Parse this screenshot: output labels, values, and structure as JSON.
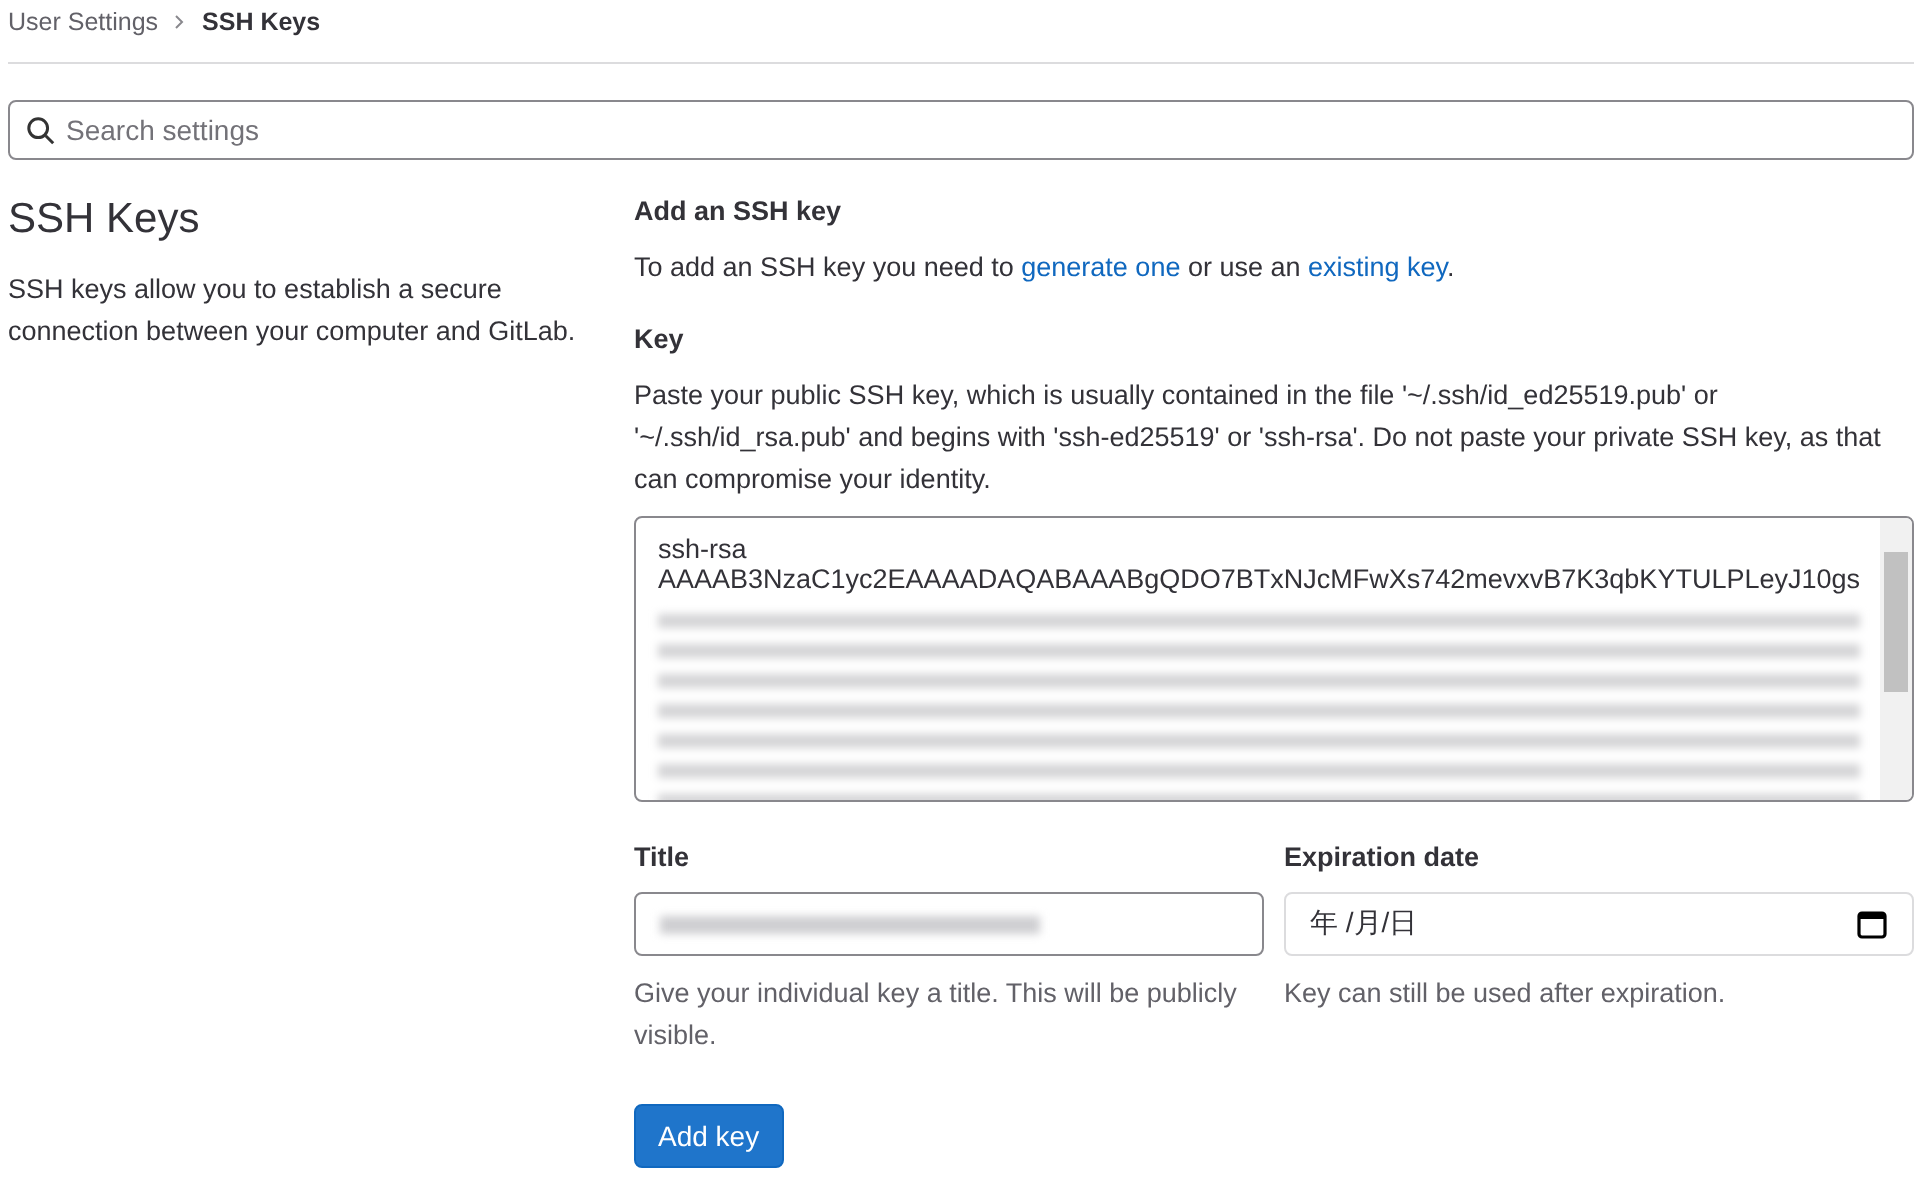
{
  "breadcrumb": [
    {
      "label": "User Settings",
      "current": false
    },
    {
      "label": "SSH Keys",
      "current": true
    }
  ],
  "search": {
    "placeholder": "Search settings"
  },
  "section": {
    "title": "SSH Keys",
    "description": "SSH keys allow you to establish a secure connection between your computer and GitLab."
  },
  "form": {
    "heading": "Add an SSH key",
    "intro": [
      {
        "kind": "text",
        "text": "To add an SSH key you need to "
      },
      {
        "kind": "link",
        "text": "generate one"
      },
      {
        "kind": "text",
        "text": " or use an "
      },
      {
        "kind": "link",
        "text": "existing key"
      },
      {
        "kind": "text",
        "text": "."
      }
    ],
    "key": {
      "label": "Key",
      "help": "Paste your public SSH key, which is usually contained in the file '~/.ssh/id_ed25519.pub' or '~/.ssh/id_rsa.pub' and begins with 'ssh-ed25519' or 'ssh-rsa'. Do not paste your private SSH key, as that can compromise your identity.",
      "value_lines": [
        "ssh-rsa",
        "AAAAB3NzaC1yc2EAAAADAQABAAABgQDO7BTxNJcMFwXs742mevxvB7K3qbKYTULPLeyJ10gs"
      ]
    },
    "title": {
      "label": "Title",
      "help": "Give your individual key a title. This will be publicly visible."
    },
    "expiration": {
      "label": "Expiration date",
      "value": "年 /月/日",
      "help": "Key can still be used after expiration."
    },
    "submit": "Add key"
  }
}
